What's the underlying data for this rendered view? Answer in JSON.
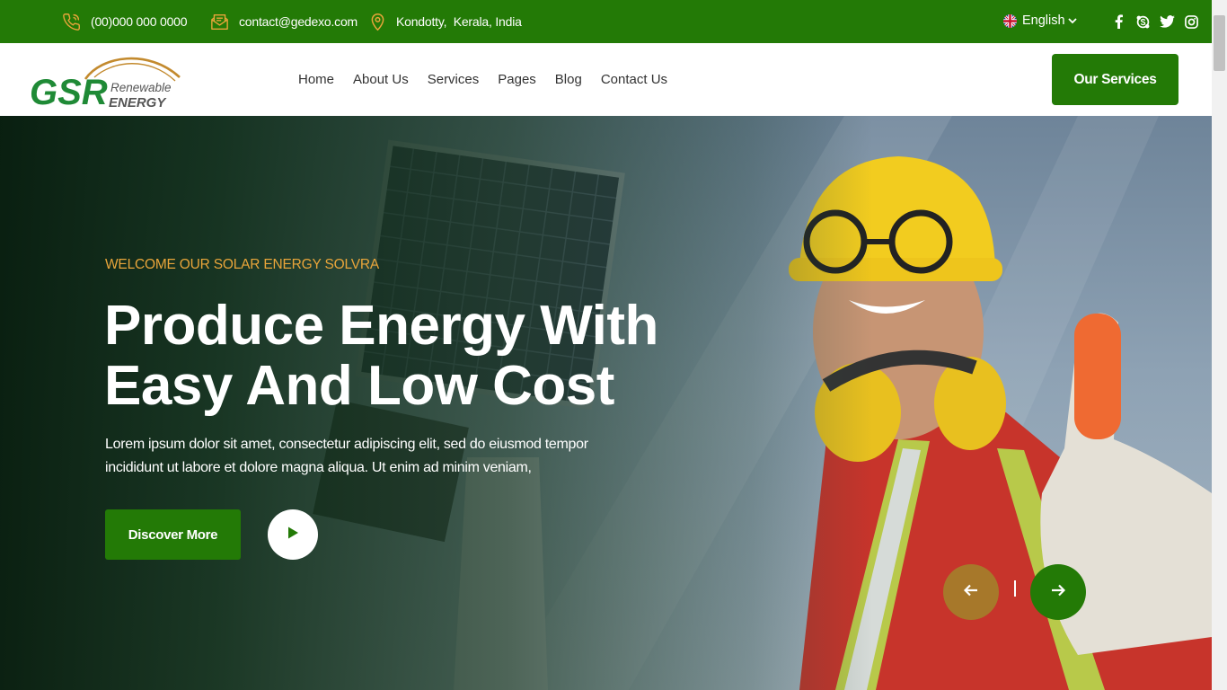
{
  "topbar": {
    "phone": "(00)000 000 0000",
    "email": "contact@gedexo.com",
    "location": "Kondotty,  Kerala, India",
    "language": "English",
    "icons": [
      "phone-icon",
      "mail-icon",
      "location-pin-icon",
      "uk-flag-icon",
      "facebook-icon",
      "skype-icon",
      "twitter-icon",
      "instagram-icon"
    ]
  },
  "logo": {
    "brand": "GSR",
    "line1": "Renewable",
    "line2": "ENERGY"
  },
  "nav": {
    "items": [
      {
        "label": "Home"
      },
      {
        "label": "About Us"
      },
      {
        "label": "Services"
      },
      {
        "label": "Pages"
      },
      {
        "label": "Blog"
      },
      {
        "label": "Contact Us"
      }
    ],
    "cta": "Our Services"
  },
  "hero": {
    "kicker": "WELCOME OUR SOLAR ENERGY SOLVRA",
    "headline": "Produce Energy With Easy And Low Cost",
    "lead": "Lorem ipsum dolor sit amet, consectetur adipiscing elit, sed do eiusmod tempor incididunt ut labore et dolore magna aliqua. Ut enim ad minim veniam,",
    "discover_label": "Discover More"
  },
  "colors": {
    "brand_green": "#237a06",
    "accent_gold": "#a7782a",
    "kicker_orange": "#e9a53a"
  }
}
